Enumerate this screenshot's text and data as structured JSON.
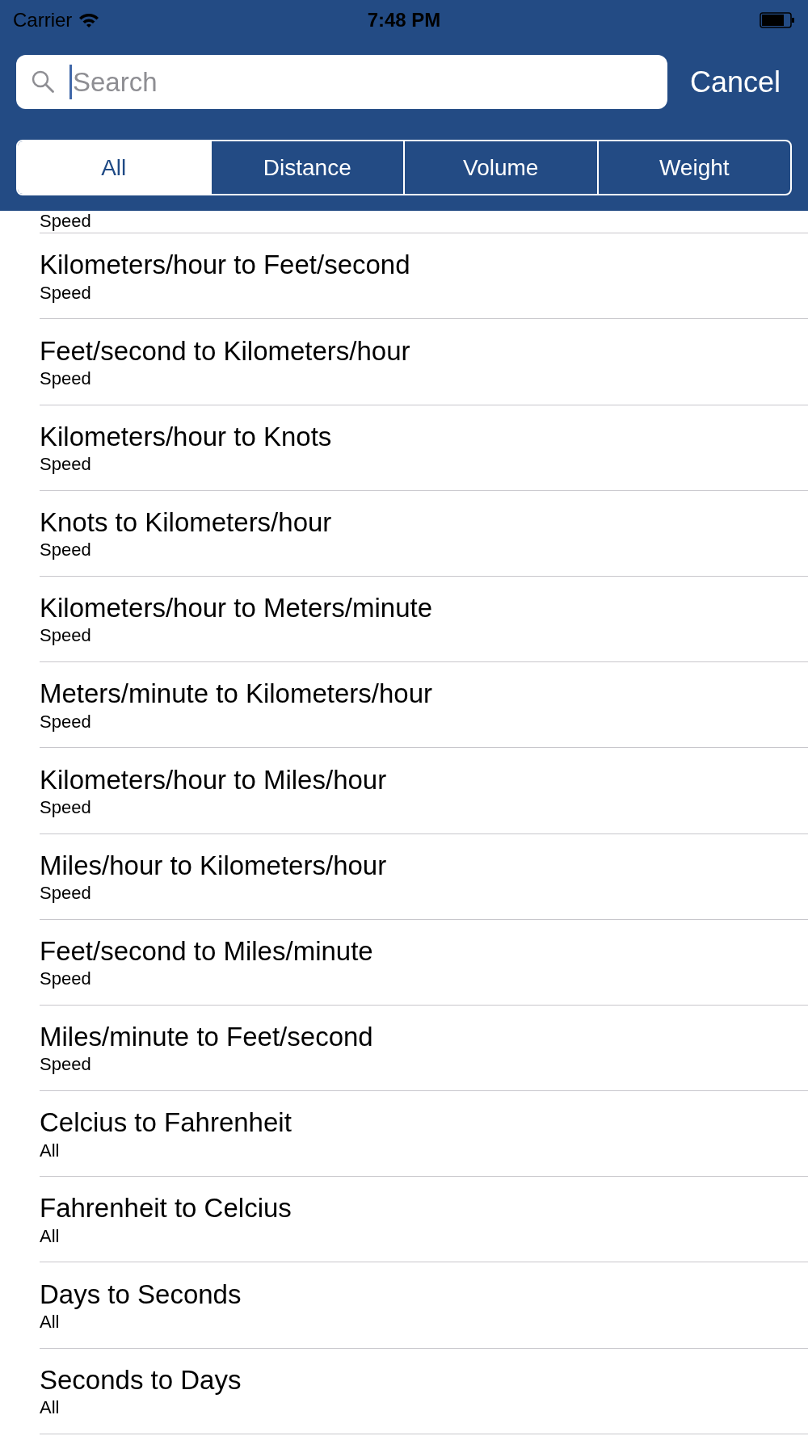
{
  "status_bar": {
    "carrier": "Carrier",
    "time": "7:48 PM"
  },
  "search": {
    "placeholder": "Search",
    "cancel": "Cancel"
  },
  "segments": [
    {
      "label": "All",
      "selected": true
    },
    {
      "label": "Distance",
      "selected": false
    },
    {
      "label": "Volume",
      "selected": false
    },
    {
      "label": "Weight",
      "selected": false
    }
  ],
  "rows": [
    {
      "subtitle": "Speed"
    },
    {
      "title": "Kilometers/hour to Feet/second",
      "subtitle": "Speed"
    },
    {
      "title": "Feet/second to Kilometers/hour",
      "subtitle": "Speed"
    },
    {
      "title": "Kilometers/hour to Knots",
      "subtitle": "Speed"
    },
    {
      "title": "Knots to Kilometers/hour",
      "subtitle": "Speed"
    },
    {
      "title": "Kilometers/hour to Meters/minute",
      "subtitle": "Speed"
    },
    {
      "title": "Meters/minute to Kilometers/hour",
      "subtitle": "Speed"
    },
    {
      "title": "Kilometers/hour to Miles/hour",
      "subtitle": "Speed"
    },
    {
      "title": "Miles/hour to Kilometers/hour",
      "subtitle": "Speed"
    },
    {
      "title": "Feet/second to Miles/minute",
      "subtitle": "Speed"
    },
    {
      "title": "Miles/minute to Feet/second",
      "subtitle": "Speed"
    },
    {
      "title": "Celcius to Fahrenheit",
      "subtitle": "All"
    },
    {
      "title": "Fahrenheit to Celcius",
      "subtitle": "All"
    },
    {
      "title": "Days to Seconds",
      "subtitle": "All"
    },
    {
      "title": "Seconds to Days",
      "subtitle": "All"
    }
  ]
}
